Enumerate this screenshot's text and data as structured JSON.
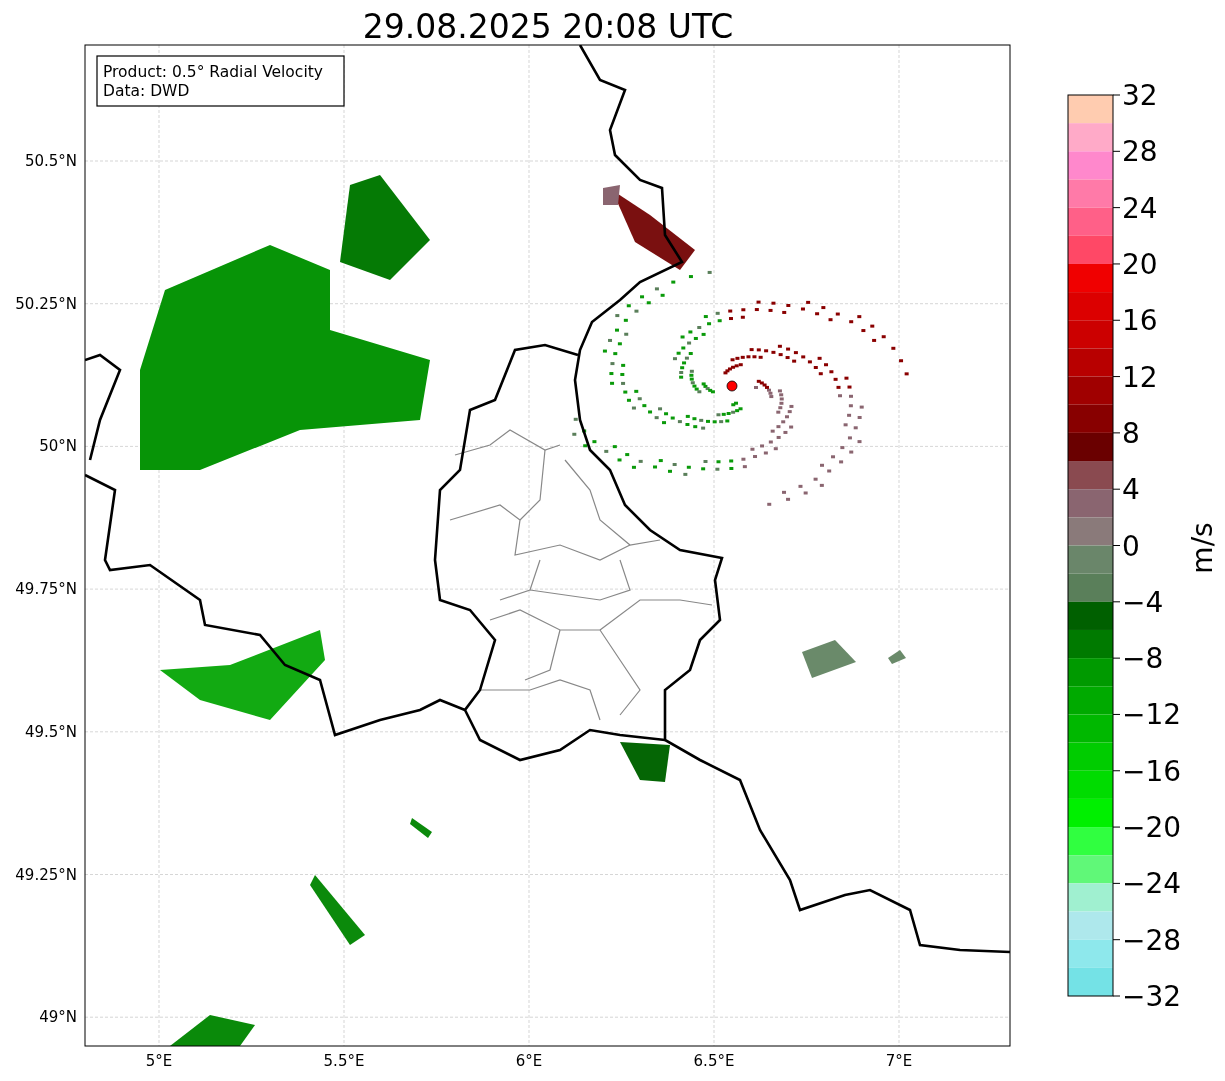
{
  "title": "29.08.2025 20:08 UTC",
  "info_box": {
    "lines": [
      "Product: 0.5° Radial Velocity",
      "Data: DWD"
    ]
  },
  "x_tick_labels": [
    "5°E",
    "5.5°E",
    "6°E",
    "6.5°E",
    "7°E"
  ],
  "y_tick_labels": [
    "50.5°N",
    "50.25°N",
    "50°N",
    "49.75°N",
    "49.5°N",
    "49.25°N",
    "49°N"
  ],
  "colorbar": {
    "label": "m/s",
    "tick_labels": [
      "32",
      "28",
      "24",
      "20",
      "16",
      "12",
      "8",
      "4",
      "0",
      "−4",
      "−8",
      "−12",
      "−16",
      "−20",
      "−24",
      "−28",
      "−32"
    ],
    "segments": [
      {
        "color": "#ffccb0"
      },
      {
        "color": "#ffaac8"
      },
      {
        "color": "#ff88cc"
      },
      {
        "color": "#ff7aa8"
      },
      {
        "color": "#ff6088"
      },
      {
        "color": "#ff4866"
      },
      {
        "color": "#f00000"
      },
      {
        "color": "#dc0000"
      },
      {
        "color": "#cc0000"
      },
      {
        "color": "#b80000"
      },
      {
        "color": "#a00000"
      },
      {
        "color": "#880000"
      },
      {
        "color": "#6a0000"
      },
      {
        "color": "#8a4a50"
      },
      {
        "color": "#8a6570"
      },
      {
        "color": "#8a7a7a"
      },
      {
        "color": "#6a866a"
      },
      {
        "color": "#5a7f5a"
      },
      {
        "color": "#006000"
      },
      {
        "color": "#007a00"
      },
      {
        "color": "#009a00"
      },
      {
        "color": "#00aa00"
      },
      {
        "color": "#00b800"
      },
      {
        "color": "#00cc00"
      },
      {
        "color": "#00dc00"
      },
      {
        "color": "#00f000"
      },
      {
        "color": "#30ff40"
      },
      {
        "color": "#60f878"
      },
      {
        "color": "#a0f0d0"
      },
      {
        "color": "#aee8ec"
      },
      {
        "color": "#8ee8ec"
      },
      {
        "color": "#74e2e6"
      }
    ]
  }
}
